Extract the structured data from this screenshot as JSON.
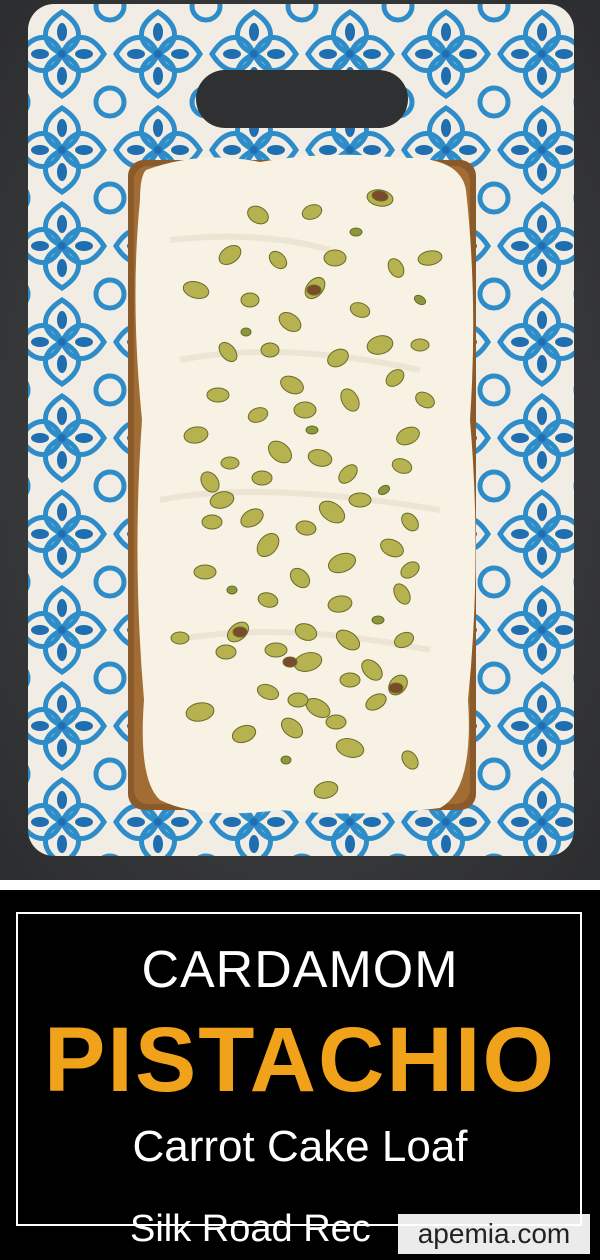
{
  "photo": {
    "subject": "loaf cake with cream cheese frosting topped with chopped pistachios on a blue patterned ceramic board",
    "colors": {
      "board": "#f1ede4",
      "pattern": "#2e8cc8",
      "frosting": "#f7f2e4",
      "crust": "#8a5a2b",
      "pistachio": "#a9b04a",
      "background": "#3a3b3d"
    }
  },
  "title": {
    "line1": "CARDAMOM",
    "line2": "PISTACHIO",
    "line3": "Carrot Cake Loaf",
    "colors": {
      "line1": "#ffffff",
      "line2": "#f0a21a",
      "line3": "#ffffff"
    }
  },
  "brand": {
    "text": "Silk Road Rec"
  },
  "watermark": {
    "text": "apemia.com"
  }
}
